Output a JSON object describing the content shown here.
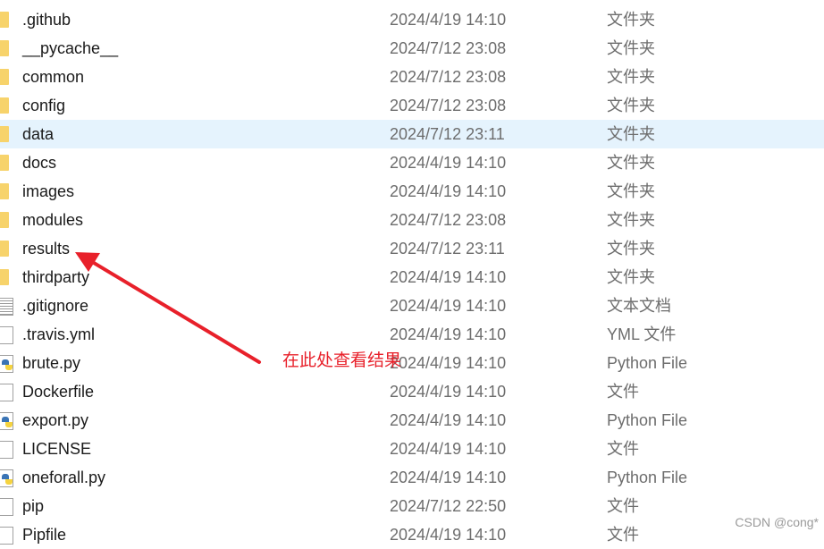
{
  "files": [
    {
      "name": ".github",
      "date": "2024/4/19 14:10",
      "type": "文件夹",
      "icon": "folder-icon"
    },
    {
      "name": "__pycache__",
      "date": "2024/7/12 23:08",
      "type": "文件夹",
      "icon": "folder-icon"
    },
    {
      "name": "common",
      "date": "2024/7/12 23:08",
      "type": "文件夹",
      "icon": "folder-icon"
    },
    {
      "name": "config",
      "date": "2024/7/12 23:08",
      "type": "文件夹",
      "icon": "folder-icon"
    },
    {
      "name": "data",
      "date": "2024/7/12 23:11",
      "type": "文件夹",
      "icon": "folder-icon",
      "selected": true
    },
    {
      "name": "docs",
      "date": "2024/4/19 14:10",
      "type": "文件夹",
      "icon": "folder-icon"
    },
    {
      "name": "images",
      "date": "2024/4/19 14:10",
      "type": "文件夹",
      "icon": "folder-icon"
    },
    {
      "name": "modules",
      "date": "2024/7/12 23:08",
      "type": "文件夹",
      "icon": "folder-icon"
    },
    {
      "name": "results",
      "date": "2024/7/12 23:11",
      "type": "文件夹",
      "icon": "folder-icon"
    },
    {
      "name": "thirdparty",
      "date": "2024/4/19 14:10",
      "type": "文件夹",
      "icon": "folder-icon"
    },
    {
      "name": ".gitignore",
      "date": "2024/4/19 14:10",
      "type": "文本文档",
      "icon": "text-file-icon"
    },
    {
      "name": ".travis.yml",
      "date": "2024/4/19 14:10",
      "type": "YML 文件",
      "icon": "file-icon"
    },
    {
      "name": "brute.py",
      "date": "2024/4/19 14:10",
      "type": "Python File",
      "icon": "python-file-icon"
    },
    {
      "name": "Dockerfile",
      "date": "2024/4/19 14:10",
      "type": "文件",
      "icon": "file-icon"
    },
    {
      "name": "export.py",
      "date": "2024/4/19 14:10",
      "type": "Python File",
      "icon": "python-file-icon"
    },
    {
      "name": "LICENSE",
      "date": "2024/4/19 14:10",
      "type": "文件",
      "icon": "file-icon"
    },
    {
      "name": "oneforall.py",
      "date": "2024/4/19 14:10",
      "type": "Python File",
      "icon": "python-file-icon"
    },
    {
      "name": "pip",
      "date": "2024/7/12 22:50",
      "type": "文件",
      "icon": "file-icon"
    },
    {
      "name": "Pipfile",
      "date": "2024/4/19 14:10",
      "type": "文件",
      "icon": "file-icon"
    }
  ],
  "annotation": {
    "text": "在此处查看结果",
    "color": "#e8202a"
  },
  "watermark": "CSDN @cong*",
  "colors": {
    "selected_row": "#e5f3fd",
    "folder": "#f7d36b"
  }
}
